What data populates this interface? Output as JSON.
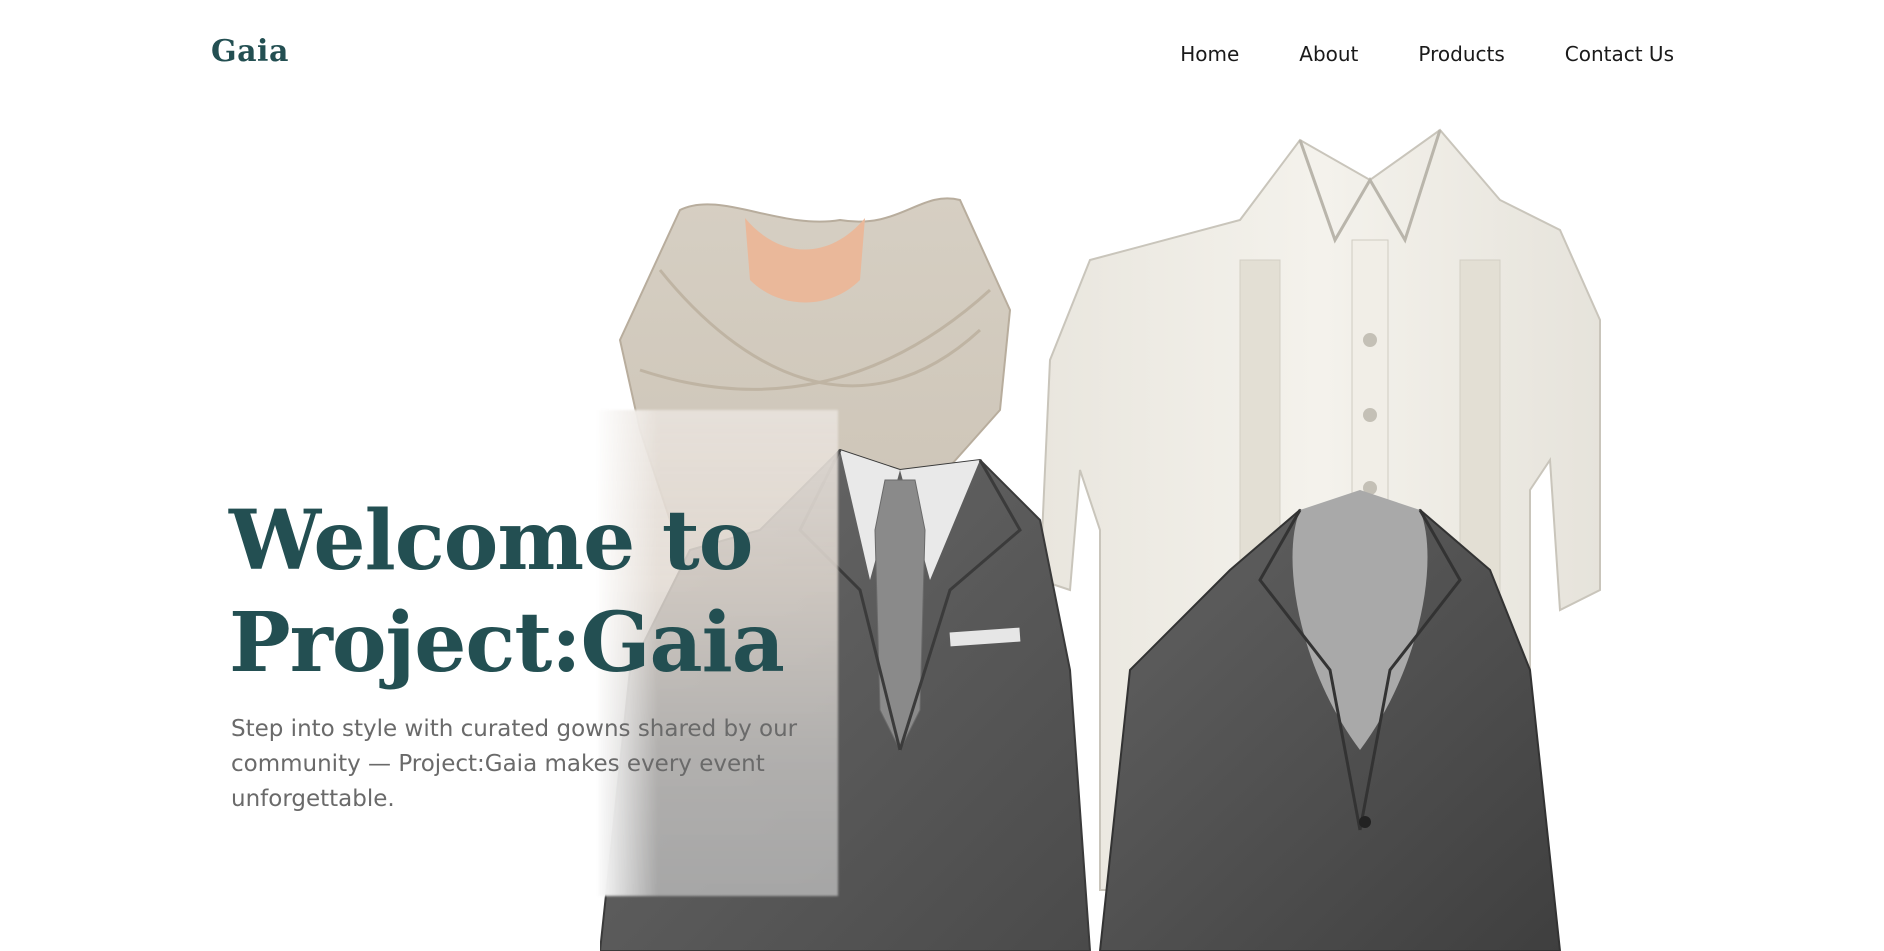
{
  "header": {
    "brand": "Gaia",
    "nav": [
      {
        "label": "Home"
      },
      {
        "label": "About"
      },
      {
        "label": "Products"
      },
      {
        "label": "Contact Us"
      }
    ]
  },
  "hero": {
    "title_line1": "Welcome to",
    "title_line2": "Project:Gaia",
    "subtitle": "Step into style with curated gowns shared by our community — Project:Gaia makes every event unforgettable."
  },
  "colors": {
    "brand": "#234f52",
    "nav_text": "#1a1a1a",
    "subtitle_text": "#6a6a6a",
    "background": "#ffffff"
  }
}
